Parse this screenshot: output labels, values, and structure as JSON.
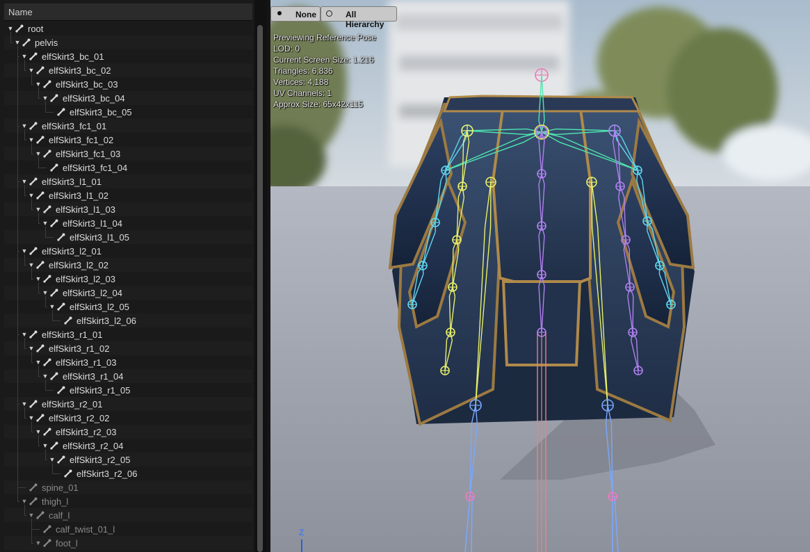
{
  "tree": {
    "header": "Name",
    "rows": [
      {
        "label": "root",
        "depth": 0,
        "expanded": true,
        "dim": false
      },
      {
        "label": "pelvis",
        "depth": 1,
        "expanded": true,
        "dim": false
      },
      {
        "label": "elfSkirt3_bc_01",
        "depth": 2,
        "expanded": true,
        "dim": false
      },
      {
        "label": "elfSkirt3_bc_02",
        "depth": 3,
        "expanded": true,
        "dim": false
      },
      {
        "label": "elfSkirt3_bc_03",
        "depth": 4,
        "expanded": true,
        "dim": false
      },
      {
        "label": "elfSkirt3_bc_04",
        "depth": 5,
        "expanded": true,
        "dim": false
      },
      {
        "label": "elfSkirt3_bc_05",
        "depth": 6,
        "expanded": false,
        "dim": false
      },
      {
        "label": "elfSkirt3_fc1_01",
        "depth": 2,
        "expanded": true,
        "dim": false
      },
      {
        "label": "elfSkirt3_fc1_02",
        "depth": 3,
        "expanded": true,
        "dim": false
      },
      {
        "label": "elfSkirt3_fc1_03",
        "depth": 4,
        "expanded": true,
        "dim": false
      },
      {
        "label": "elfSkirt3_fc1_04",
        "depth": 5,
        "expanded": false,
        "dim": false
      },
      {
        "label": "elfSkirt3_l1_01",
        "depth": 2,
        "expanded": true,
        "dim": false
      },
      {
        "label": "elfSkirt3_l1_02",
        "depth": 3,
        "expanded": true,
        "dim": false
      },
      {
        "label": "elfSkirt3_l1_03",
        "depth": 4,
        "expanded": true,
        "dim": false
      },
      {
        "label": "elfSkirt3_l1_04",
        "depth": 5,
        "expanded": true,
        "dim": false
      },
      {
        "label": "elfSkirt3_l1_05",
        "depth": 6,
        "expanded": false,
        "dim": false
      },
      {
        "label": "elfSkirt3_l2_01",
        "depth": 2,
        "expanded": true,
        "dim": false
      },
      {
        "label": "elfSkirt3_l2_02",
        "depth": 3,
        "expanded": true,
        "dim": false
      },
      {
        "label": "elfSkirt3_l2_03",
        "depth": 4,
        "expanded": true,
        "dim": false
      },
      {
        "label": "elfSkirt3_l2_04",
        "depth": 5,
        "expanded": true,
        "dim": false
      },
      {
        "label": "elfSkirt3_l2_05",
        "depth": 6,
        "expanded": true,
        "dim": false
      },
      {
        "label": "elfSkirt3_l2_06",
        "depth": 7,
        "expanded": false,
        "dim": false
      },
      {
        "label": "elfSkirt3_r1_01",
        "depth": 2,
        "expanded": true,
        "dim": false
      },
      {
        "label": "elfSkirt3_r1_02",
        "depth": 3,
        "expanded": true,
        "dim": false
      },
      {
        "label": "elfSkirt3_r1_03",
        "depth": 4,
        "expanded": true,
        "dim": false
      },
      {
        "label": "elfSkirt3_r1_04",
        "depth": 5,
        "expanded": true,
        "dim": false
      },
      {
        "label": "elfSkirt3_r1_05",
        "depth": 6,
        "expanded": false,
        "dim": false
      },
      {
        "label": "elfSkirt3_r2_01",
        "depth": 2,
        "expanded": true,
        "dim": false
      },
      {
        "label": "elfSkirt3_r2_02",
        "depth": 3,
        "expanded": true,
        "dim": false
      },
      {
        "label": "elfSkirt3_r2_03",
        "depth": 4,
        "expanded": true,
        "dim": false
      },
      {
        "label": "elfSkirt3_r2_04",
        "depth": 5,
        "expanded": true,
        "dim": false
      },
      {
        "label": "elfSkirt3_r2_05",
        "depth": 6,
        "expanded": true,
        "dim": false
      },
      {
        "label": "elfSkirt3_r2_06",
        "depth": 7,
        "expanded": false,
        "dim": false
      },
      {
        "label": "spine_01",
        "depth": 2,
        "expanded": false,
        "dim": true
      },
      {
        "label": "thigh_l",
        "depth": 2,
        "expanded": true,
        "dim": true
      },
      {
        "label": "calf_l",
        "depth": 3,
        "expanded": true,
        "dim": true
      },
      {
        "label": "calf_twist_01_l",
        "depth": 4,
        "expanded": false,
        "dim": true
      },
      {
        "label": "foot_l",
        "depth": 4,
        "expanded": true,
        "dim": true
      }
    ]
  },
  "viewport": {
    "buttons": {
      "none_label": "None",
      "all_hierarchy_label": "All Hierarchy"
    },
    "stats": {
      "line1": "Previewing Reference Pose",
      "line2": "LOD: 0",
      "line3": "Current Screen Size: 1.216",
      "line4": "Triangles: 6,836",
      "line5": "Vertices: 4,188",
      "line6": "UV Channels: 1",
      "line7": "Approx Size: 65x42x115"
    },
    "axis_label": "Z"
  },
  "colors": {
    "bone_green": "#4fe6b0",
    "bone_yellow": "#e8f06a",
    "bone_purple": "#b080f0",
    "bone_pink": "#f07ab8",
    "bone_cyan": "#5fd8f0",
    "bone_red": "#f08080",
    "bone_blue": "#7aa8ff",
    "skirt_fabric": "#2c3f5e",
    "skirt_trim": "#b08a4a"
  }
}
